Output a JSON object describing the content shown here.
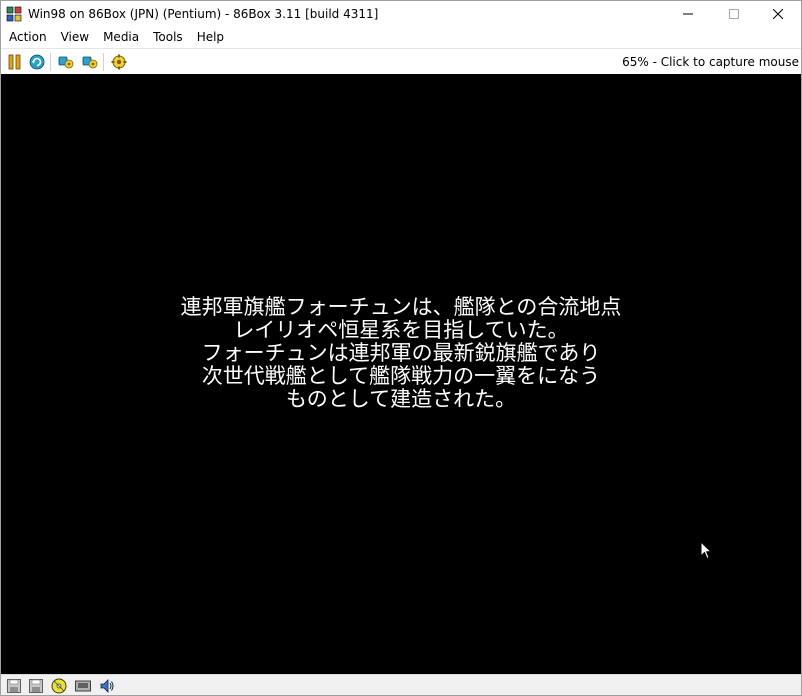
{
  "window": {
    "title": "Win98 on 86Box (JPN) (Pentium) - 86Box 3.11 [build 4311]"
  },
  "menu": {
    "items": [
      {
        "label": "Action"
      },
      {
        "label": "View"
      },
      {
        "label": "Media"
      },
      {
        "label": "Tools"
      },
      {
        "label": "Help"
      }
    ]
  },
  "toolbar": {
    "buttons": [
      {
        "icon": "pause-icon"
      },
      {
        "icon": "reset-icon"
      },
      {
        "icon": "ctrl-alt-del-icon"
      },
      {
        "icon": "ctrl-alt-esc-icon"
      },
      {
        "icon": "settings-icon"
      }
    ],
    "status_text": "65% - Click to capture mouse"
  },
  "screen": {
    "lines": [
      "連邦軍旗艦フォーチュンは、艦隊との合流地点",
      "レイリオペ恒星系を目指していた。",
      "フォーチュンは連邦軍の最新鋭旗艦であり",
      "次世代戦艦として艦隊戦力の一翼をになう",
      "ものとして建造された。"
    ]
  },
  "statusbar": {
    "icons": [
      {
        "icon": "floppy-drive-icon"
      },
      {
        "icon": "floppy-drive-icon"
      },
      {
        "icon": "cdrom-drive-icon"
      },
      {
        "icon": "network-icon"
      },
      {
        "icon": "sound-icon"
      }
    ]
  },
  "colors": {
    "screen_bg": "#000000",
    "screen_text": "#ffffff",
    "statusbar_bg": "#f0f0f0"
  }
}
